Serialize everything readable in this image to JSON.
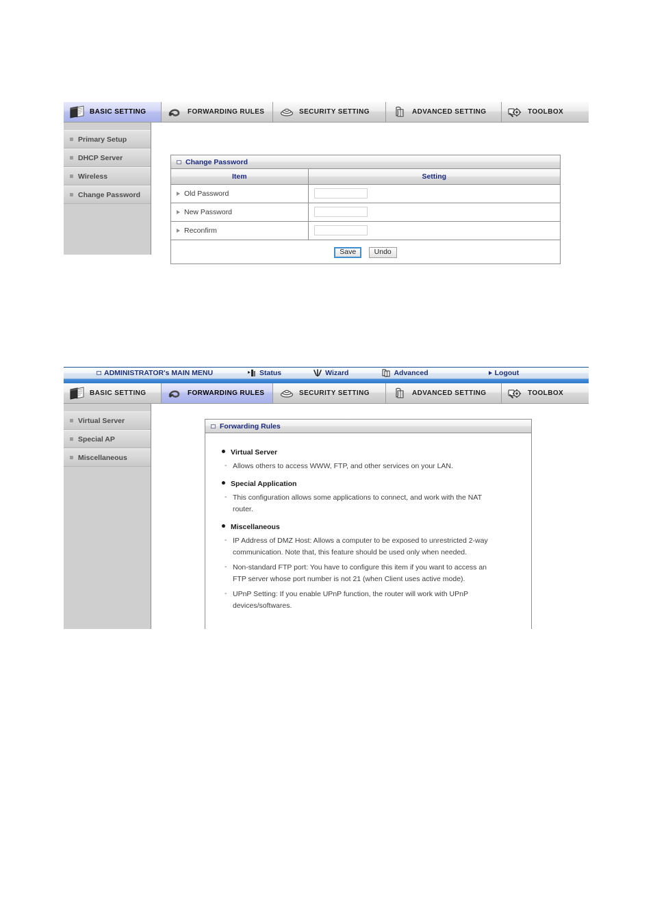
{
  "screenshot1": {
    "tabs": [
      {
        "label": "BASIC SETTING",
        "icon": "documents-icon",
        "active": true
      },
      {
        "label": "FORWARDING RULES",
        "icon": "arrow-loop-icon",
        "active": false
      },
      {
        "label": "SECURITY SETTING",
        "icon": "shield-lock-icon",
        "active": false
      },
      {
        "label": "ADVANCED SETTING",
        "icon": "books-icon",
        "active": false
      },
      {
        "label": "TOOLBOX",
        "icon": "gear-wrench-icon",
        "active": false
      }
    ],
    "sidebar": {
      "items": [
        {
          "label": "Primary Setup"
        },
        {
          "label": "DHCP Server"
        },
        {
          "label": "Wireless"
        },
        {
          "label": "Change Password"
        }
      ]
    },
    "panel": {
      "title": "Change Password",
      "columns": {
        "item": "Item",
        "setting": "Setting"
      },
      "rows": [
        {
          "label": "Old Password",
          "value": ""
        },
        {
          "label": "New Password",
          "value": ""
        },
        {
          "label": "Reconfirm",
          "value": ""
        }
      ],
      "buttons": {
        "save": "Save",
        "undo": "Undo"
      }
    }
  },
  "screenshot2": {
    "adminbar": {
      "title": "ADMINISTRATOR's MAIN MENU",
      "items": [
        {
          "label": "Status",
          "icon": "status-bar-icon"
        },
        {
          "label": "Wizard",
          "icon": "wand-icon"
        },
        {
          "label": "Advanced",
          "icon": "books-icon"
        },
        {
          "label": "Logout",
          "icon": "arrow-right-icon"
        }
      ]
    },
    "tabs": [
      {
        "label": "BASIC SETTING",
        "icon": "documents-icon",
        "active": false
      },
      {
        "label": "FORWARDING RULES",
        "icon": "arrow-loop-icon",
        "active": true
      },
      {
        "label": "SECURITY SETTING",
        "icon": "shield-lock-icon",
        "active": false
      },
      {
        "label": "ADVANCED SETTING",
        "icon": "books-icon",
        "active": false
      },
      {
        "label": "TOOLBOX",
        "icon": "gear-wrench-icon",
        "active": false
      }
    ],
    "sidebar": {
      "items": [
        {
          "label": "Virtual Server"
        },
        {
          "label": "Special AP"
        },
        {
          "label": "Miscellaneous"
        }
      ]
    },
    "panel": {
      "title": "Forwarding Rules",
      "groups": [
        {
          "title": "Virtual Server",
          "lines": [
            "Allows others to access WWW, FTP, and other services on your LAN."
          ]
        },
        {
          "title": "Special Application",
          "lines": [
            "This configuration allows some applications to connect, and work with the NAT router."
          ]
        },
        {
          "title": "Miscellaneous",
          "lines": [
            "IP Address of DMZ Host: Allows a computer to be exposed to unrestricted 2-way communication. Note that, this feature should be used only when needed.",
            "Non-standard FTP port: You have to configure this item if you want to access an FTP server whose port number is not 21 (when Client uses active mode).",
            "UPnP Setting: If you enable UPnP function, the router will work with UPnP devices/softwares."
          ]
        }
      ]
    }
  },
  "colors": {
    "accent_blue": "#2b6fc4",
    "tab_active": "#b9c0ef",
    "heading_navy": "#1b2a7e",
    "sidebar_gray": "#cfcfcf"
  }
}
